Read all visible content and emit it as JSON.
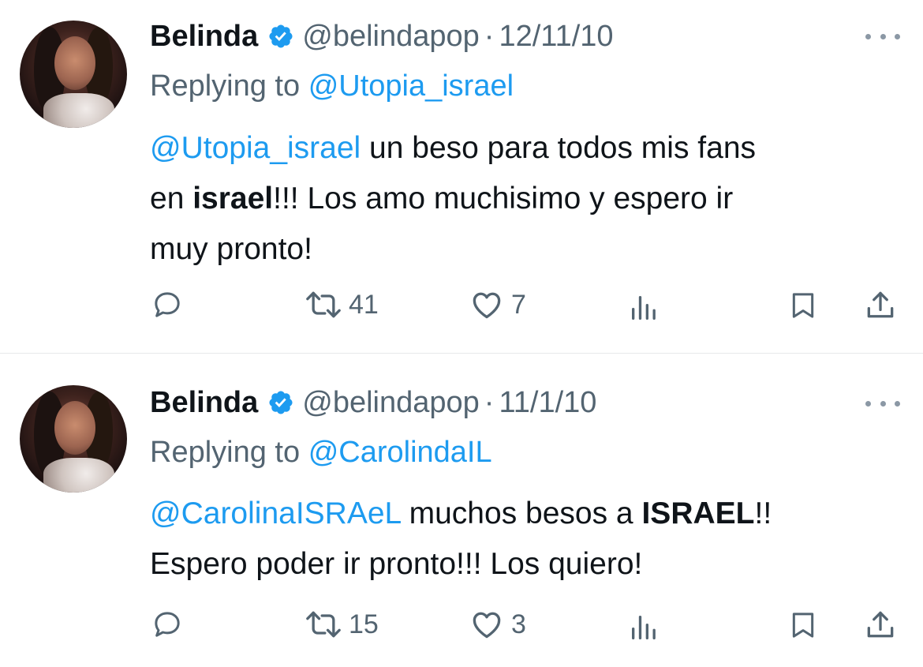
{
  "tweets": [
    {
      "name": "Belinda",
      "handle": "@belindapop",
      "separator": "·",
      "date": "12/11/10",
      "replying_prefix": "Replying to",
      "replying_to": "@Utopia_israel",
      "mention": "@Utopia_israel",
      "line1_rest": " un beso para todos mis fans",
      "line2_pre": "en ",
      "line2_bold": "israel",
      "line2_rest": "!!! Los amo muchisimo y espero ir",
      "line3": "muy pronto!",
      "retweets": "41",
      "likes": "7"
    },
    {
      "name": "Belinda",
      "handle": "@belindapop",
      "separator": "·",
      "date": "11/1/10",
      "replying_prefix": "Replying to",
      "replying_to": "@CarolindaIL",
      "mention": "@CarolinaISRAeL",
      "line1_mid": " muchos besos a ",
      "line1_bold": "ISRAEL",
      "line1_end": "!!",
      "line2": "Espero poder ir pronto!!! Los quiero!",
      "retweets": "15",
      "likes": "3"
    }
  ],
  "icons": {
    "verified": "verified-badge-icon",
    "more": "more-options-icon",
    "reply": "reply-icon",
    "retweet": "retweet-icon",
    "like": "like-icon",
    "views": "views-icon",
    "bookmark": "bookmark-icon",
    "share": "share-icon"
  },
  "colors": {
    "link": "#1d9bf0",
    "secondary_text": "#536471",
    "primary_text": "#0f1419",
    "divider": "#e7e9ea"
  }
}
